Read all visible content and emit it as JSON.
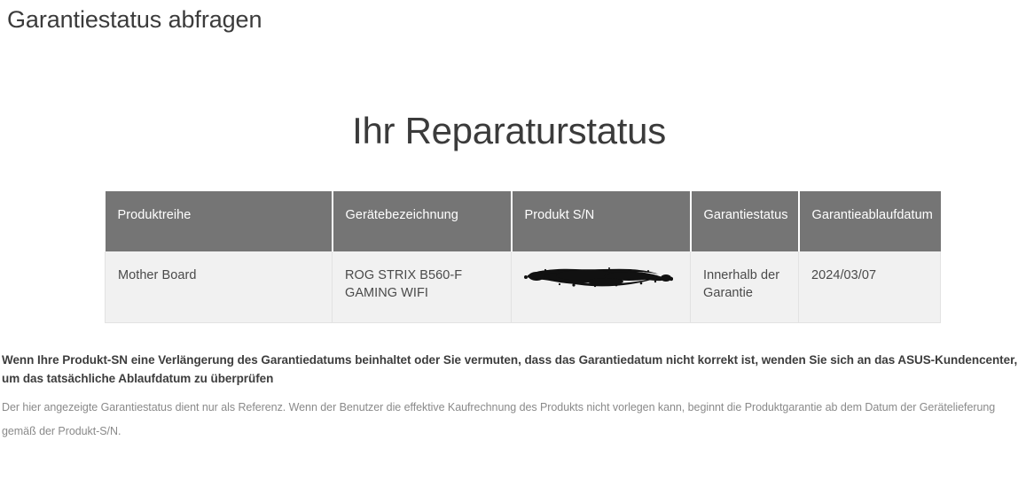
{
  "page": {
    "title": "Garantiestatus abfragen",
    "heading": "Ihr Reparaturstatus"
  },
  "table": {
    "columns": [
      {
        "key": "series",
        "label": "Produktreihe"
      },
      {
        "key": "model",
        "label": "Gerätebezeichnung"
      },
      {
        "key": "sn",
        "label": "Produkt S/N"
      },
      {
        "key": "status",
        "label": "Garantiestatus"
      },
      {
        "key": "expiry",
        "label": "Garantieablaufdatum"
      }
    ],
    "rows": [
      {
        "series": "Mother Board",
        "model": "ROG STRIX B560-F GAMING WIFI",
        "sn": "",
        "sn_redacted": true,
        "status": "Innerhalb der Garantie",
        "expiry": "2024/03/07"
      }
    ],
    "header_background": "#757575",
    "header_text_color": "#ffffff",
    "row_background": "#f1f1f1"
  },
  "notes": {
    "strong": "Wenn Ihre Produkt-SN eine Verlängerung des Garantiedatums beinhaltet oder Sie vermuten, dass das Garantiedatum nicht korrekt ist, wenden Sie sich an das ASUS-Kundencenter, um das tatsächliche Ablaufdatum zu überprüfen",
    "small": "Der hier angezeigte Garantiestatus dient nur als Referenz. Wenn der Benutzer die effektive Kaufrechnung des Produkts nicht vorlegen kann, beginnt die Produktgarantie ab dem Datum der Gerätelieferung gemäß der Produkt-S/N."
  }
}
